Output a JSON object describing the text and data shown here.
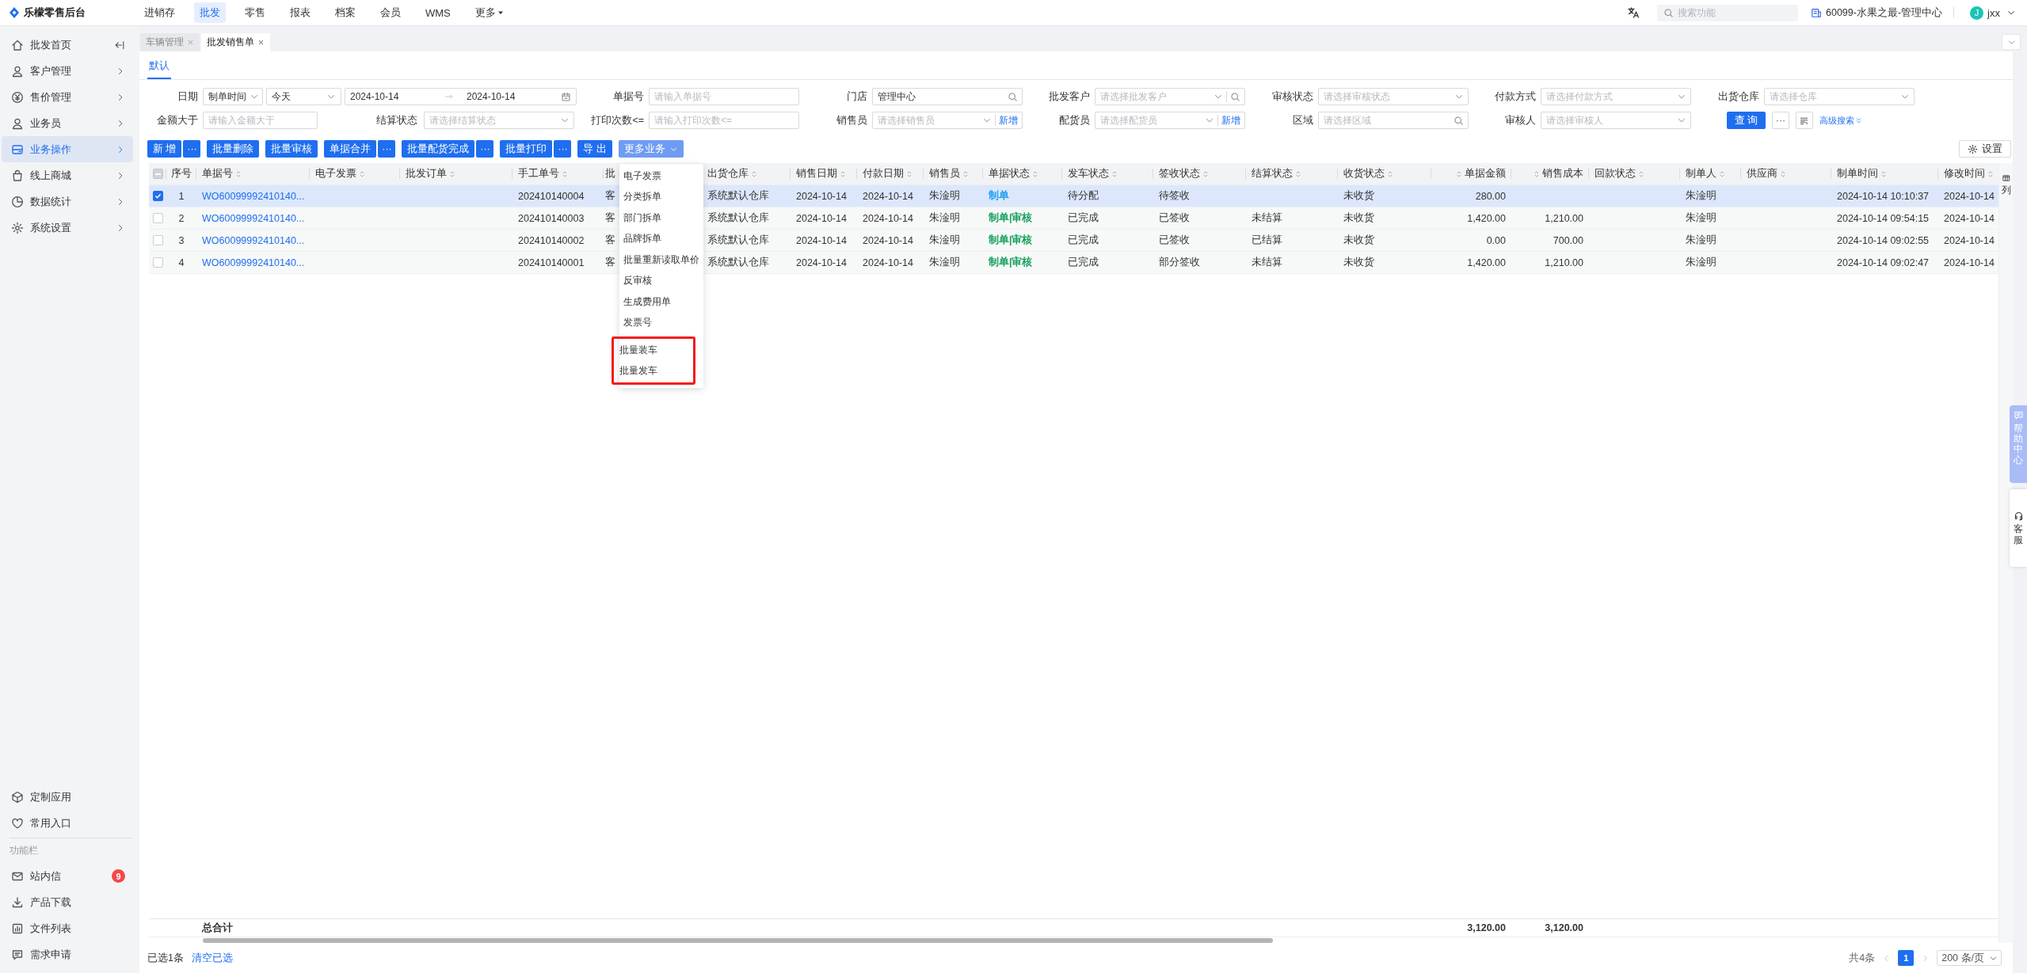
{
  "app": {
    "title": "乐檬零售后台"
  },
  "top_nav": [
    {
      "label": "进销存",
      "selected": false,
      "kind": "link"
    },
    {
      "label": "批发",
      "selected": true,
      "kind": "link"
    },
    {
      "label": "零售",
      "selected": false,
      "kind": "link"
    },
    {
      "label": "报表",
      "selected": false,
      "kind": "link"
    },
    {
      "label": "档案",
      "selected": false,
      "kind": "link"
    },
    {
      "label": "会员",
      "selected": false,
      "kind": "link"
    },
    {
      "label": "WMS",
      "selected": false,
      "kind": "link"
    },
    {
      "label": "更多",
      "selected": false,
      "kind": "menu"
    }
  ],
  "header": {
    "search_placeholder": "搜索功能",
    "store": "60099-水果之最-管理中心",
    "user_initial": "J",
    "user_name": "jxx"
  },
  "sidebar": {
    "items": [
      {
        "label": "批发首页",
        "selected": false,
        "kind": "pinned"
      },
      {
        "label": "客户管理",
        "selected": false,
        "kind": "group"
      },
      {
        "label": "售价管理",
        "selected": false,
        "kind": "group"
      },
      {
        "label": "业务员",
        "selected": false,
        "kind": "group"
      },
      {
        "label": "业务操作",
        "selected": true,
        "kind": "group"
      },
      {
        "label": "线上商城",
        "selected": false,
        "kind": "group"
      },
      {
        "label": "数据统计",
        "selected": false,
        "kind": "group"
      },
      {
        "label": "系统设置",
        "selected": false,
        "kind": "group"
      }
    ],
    "shortcuts": [
      {
        "label": "定制应用"
      },
      {
        "label": "常用入口"
      }
    ],
    "tools_title": "功能栏",
    "tools": [
      {
        "label": "站内信",
        "badge": "9"
      },
      {
        "label": "产品下载"
      },
      {
        "label": "文件列表"
      },
      {
        "label": "需求申请"
      }
    ]
  },
  "page_tabs": [
    {
      "label": "车辆管理",
      "selected": false
    },
    {
      "label": "批发销售单",
      "selected": true
    }
  ],
  "view_tabs": [
    {
      "label": "默认",
      "selected": true
    }
  ],
  "filters": [
    {
      "kind": "date_range",
      "label": "日期",
      "mode": "制单时间",
      "preset": "今天",
      "start": "2024-10-14",
      "end": "2024-10-14"
    },
    {
      "kind": "input",
      "label": "单据号",
      "placeholder": "请输入单据号"
    },
    {
      "kind": "search",
      "label": "门店",
      "value": "管理中心"
    },
    {
      "kind": "select_search",
      "label": "批发客户",
      "placeholder": "请选择批发客户"
    },
    {
      "kind": "select",
      "label": "审核状态",
      "placeholder": "请选择审核状态"
    },
    {
      "kind": "select",
      "label": "付款方式",
      "placeholder": "请选择付款方式"
    },
    {
      "kind": "select",
      "label": "出货仓库",
      "placeholder": "请选择仓库"
    },
    {
      "kind": "input",
      "label": "金额大于",
      "placeholder": "请输入金额大于"
    },
    {
      "kind": "select",
      "label": "结算状态",
      "placeholder": "请选择结算状态"
    },
    {
      "kind": "input",
      "label": "打印次数<=",
      "placeholder": "请输入打印次数<="
    },
    {
      "kind": "select_add",
      "label": "销售员",
      "placeholder": "请选择销售员",
      "add": "新增"
    },
    {
      "kind": "select_add",
      "label": "配货员",
      "placeholder": "请选择配货员",
      "add": "新增"
    },
    {
      "kind": "search",
      "label": "区域",
      "placeholder": "请选择区域"
    },
    {
      "kind": "select",
      "label": "审核人",
      "placeholder": "请选择审核人"
    }
  ],
  "search_actions": {
    "query": "查 询",
    "more": "···",
    "advanced": "高级搜索"
  },
  "toolbar": {
    "buttons": [
      {
        "kind": "split",
        "label": "新 增",
        "extra": "···"
      },
      {
        "kind": "plain",
        "label": "批量删除"
      },
      {
        "kind": "plain",
        "label": "批量审核"
      },
      {
        "kind": "split",
        "label": "单据合并",
        "extra": "···"
      },
      {
        "kind": "split",
        "label": "批量配货完成",
        "extra": "···"
      },
      {
        "kind": "split",
        "label": "批量打印",
        "extra": "···"
      },
      {
        "kind": "plain",
        "label": "导 出"
      },
      {
        "kind": "menu",
        "label": "更多业务",
        "expanded": true
      }
    ],
    "settings": "设置"
  },
  "more_menu": {
    "items": [
      {
        "label": "电子发票",
        "highlighted": false
      },
      {
        "label": "分类拆单",
        "highlighted": false
      },
      {
        "label": "部门拆单",
        "highlighted": false
      },
      {
        "label": "品牌拆单",
        "highlighted": false
      },
      {
        "label": "批量重新读取单价",
        "highlighted": false
      },
      {
        "label": "反审核",
        "highlighted": false
      },
      {
        "label": "生成费用单",
        "highlighted": false
      },
      {
        "label": "发票号",
        "highlighted": false
      },
      {
        "label": "批量装车",
        "highlighted": true
      },
      {
        "label": "批量发车",
        "highlighted": true
      }
    ]
  },
  "table": {
    "header_checkbox": {
      "indeterminate": true
    },
    "columns": [
      {
        "label": "序号",
        "sortable": false
      },
      {
        "label": "单据号",
        "sortable": true
      },
      {
        "label": "电子发票",
        "sortable": true
      },
      {
        "label": "批发订单",
        "sortable": true
      },
      {
        "label": "手工单号",
        "sortable": true
      },
      {
        "label": "批",
        "sortable": false
      },
      {
        "label": "出货仓库",
        "sortable": true
      },
      {
        "label": "销售日期",
        "sortable": true
      },
      {
        "label": "付款日期",
        "sortable": true
      },
      {
        "label": "销售员",
        "sortable": true
      },
      {
        "label": "单据状态",
        "sortable": true
      },
      {
        "label": "发车状态",
        "sortable": true
      },
      {
        "label": "签收状态",
        "sortable": true
      },
      {
        "label": "结算状态",
        "sortable": true
      },
      {
        "label": "收货状态",
        "sortable": true
      },
      {
        "label": "单据金额",
        "sortable": true
      },
      {
        "label": "销售成本",
        "sortable": true
      },
      {
        "label": "回款状态",
        "sortable": true
      },
      {
        "label": "制单人",
        "sortable": true
      },
      {
        "label": "供应商",
        "sortable": true
      },
      {
        "label": "制单时间",
        "sortable": true
      },
      {
        "label": "修改时间",
        "sortable": true
      }
    ],
    "rows": [
      {
        "selected": true,
        "cells": [
          "1",
          "WO60099992410140...",
          null,
          null,
          "202410140004",
          "客",
          "系统默认仓库",
          "2024-10-14",
          "2024-10-14",
          "朱淦明",
          {
            "text": "制单",
            "color": "#1e9ff2"
          },
          "待分配",
          "待签收",
          null,
          "未收货",
          "280.00",
          null,
          null,
          "朱淦明",
          null,
          "2024-10-14 10:10:37",
          "2024-10-14"
        ]
      },
      {
        "selected": false,
        "cells": [
          "2",
          "WO60099992410140...",
          null,
          null,
          "202410140003",
          "客",
          "系统默认仓库",
          "2024-10-14",
          "2024-10-14",
          "朱淦明",
          {
            "text": "制单|审核",
            "color": "#19a15f"
          },
          "已完成",
          "已签收",
          "未结算",
          "未收货",
          "1,420.00",
          "1,210.00",
          null,
          "朱淦明",
          null,
          "2024-10-14 09:54:15",
          "2024-10-14"
        ]
      },
      {
        "selected": false,
        "cells": [
          "3",
          "WO60099992410140...",
          null,
          null,
          "202410140002",
          "客",
          "系统默认仓库",
          "2024-10-14",
          "2024-10-14",
          "朱淦明",
          {
            "text": "制单|审核",
            "color": "#19a15f"
          },
          "已完成",
          "已签收",
          "已结算",
          "未收货",
          "0.00",
          "700.00",
          null,
          "朱淦明",
          null,
          "2024-10-14 09:02:55",
          "2024-10-14"
        ]
      },
      {
        "selected": false,
        "cells": [
          "4",
          "WO60099992410140...",
          null,
          null,
          "202410140001",
          "客",
          "系统默认仓库",
          "2024-10-14",
          "2024-10-14",
          "朱淦明",
          {
            "text": "制单|审核",
            "color": "#19a15f"
          },
          "已完成",
          "部分签收",
          "未结算",
          "未收货",
          "1,420.00",
          "1,210.00",
          null,
          "朱淦明",
          null,
          "2024-10-14 09:02:47",
          "2024-10-14"
        ]
      }
    ],
    "totals": {
      "cells": [
        null,
        "总合计",
        null,
        null,
        null,
        null,
        null,
        null,
        null,
        null,
        null,
        null,
        null,
        null,
        null,
        "3,120.00",
        "3,120.00",
        null,
        null,
        null,
        null,
        null
      ]
    },
    "column_button": "列"
  },
  "footer": {
    "selected_count": "已选1条",
    "clear": "清空已选",
    "total": "共4条",
    "pages": [
      {
        "label": "1",
        "selected": true
      }
    ],
    "page_size": "200 条/页"
  },
  "side_tabs": [
    {
      "label": "帮助中心",
      "kind": "help"
    },
    {
      "label": "客服",
      "kind": "service"
    }
  ]
}
